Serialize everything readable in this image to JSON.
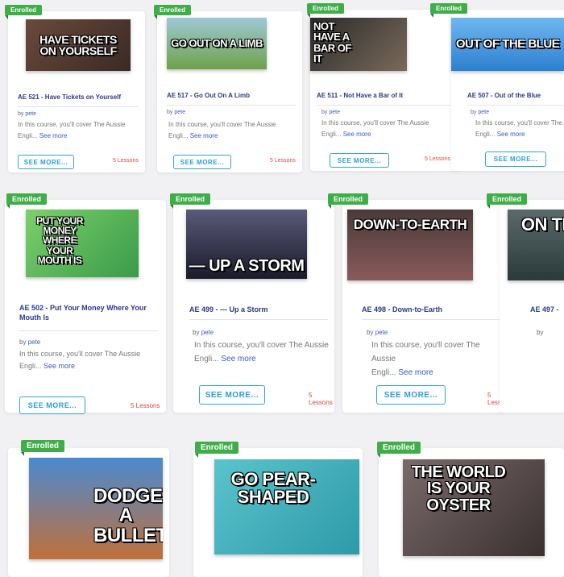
{
  "enrolled_label": "Enrolled",
  "by_label": "by",
  "author": "pete",
  "description": "In this course, you'll cover The Aussie",
  "description_cont": "Engli...",
  "see_more_link": "See more",
  "see_more_button": "SEE MORE...",
  "lessons_label": "5 Lessons",
  "courses": [
    {
      "title": "AE 521 - Have Tickets on Yourself",
      "thumb_text": "HAVE TICKETS ON YOURSELF",
      "thumb_color": "#4a3a33"
    },
    {
      "title": "AE 517 - Go Out On A Limb",
      "thumb_text": "GO OUT ON A LIMB",
      "thumb_color": "#8fbf3a"
    },
    {
      "title": "AE 511 - Not Have a Bar of It",
      "thumb_text": "NOT HAVE A BAR OF IT",
      "thumb_color": "#3b3b3b"
    },
    {
      "title": "AE 507 - Out of the Blue",
      "thumb_text": "OUT OF THE BLUE",
      "thumb_color": "#3b8fd6"
    },
    {
      "title": "AE 502 - Put Your Money Where Your Mouth Is",
      "thumb_text": "PUT YOUR MONEY WHERE YOUR MOUTH IS",
      "thumb_color": "#6bbf4a"
    },
    {
      "title": "AE 499 - — Up a Storm",
      "thumb_text": "— UP A STORM",
      "thumb_color": "#2f2f40"
    },
    {
      "title": "AE 498 - Down-to-Earth",
      "thumb_text": "DOWN-TO-EARTH",
      "thumb_color": "#5a4a3e"
    },
    {
      "title": "AE 497 -",
      "thumb_text": "ON TI",
      "thumb_color": "#3c4a4a"
    },
    {
      "title": "",
      "thumb_text": "DODGE A BULLET",
      "thumb_color": "#3a6aa8"
    },
    {
      "title": "",
      "thumb_text": "GO PEAR-SHAPED",
      "thumb_color": "#4ab8c4"
    },
    {
      "title": "",
      "thumb_text": "THE WORLD IS YOUR OYSTER",
      "thumb_color": "#5a5050"
    }
  ]
}
